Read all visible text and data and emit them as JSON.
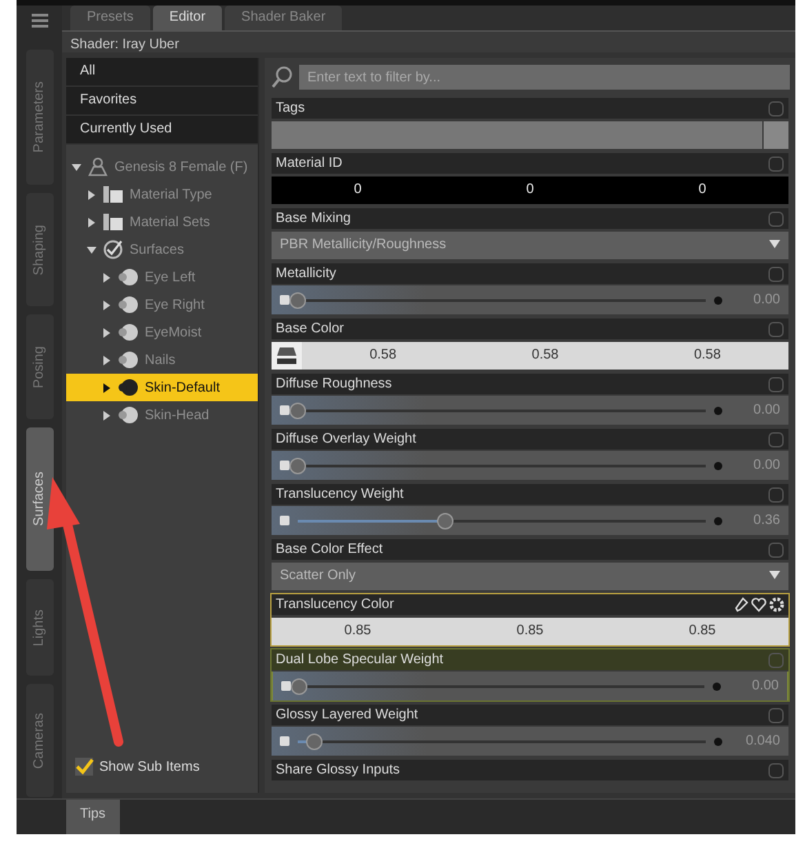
{
  "side_tabs": [
    {
      "label": "Parameters",
      "selected": false
    },
    {
      "label": "Shaping",
      "selected": false
    },
    {
      "label": "Posing",
      "selected": false
    },
    {
      "label": "Surfaces",
      "selected": true
    },
    {
      "label": "Lights",
      "selected": false
    },
    {
      "label": "Cameras",
      "selected": false
    }
  ],
  "tabs": [
    {
      "label": "Presets",
      "selected": false
    },
    {
      "label": "Editor",
      "selected": true
    },
    {
      "label": "Shader Baker",
      "selected": false
    }
  ],
  "shader_label": "Shader: Iray Uber",
  "filters": [
    "All",
    "Favorites",
    "Currently Used"
  ],
  "tree": [
    {
      "label": "Genesis 8 Female (F)",
      "kind": "figure",
      "expanded": true,
      "dimmed": true,
      "selected": false,
      "children": [
        {
          "label": "Material Type",
          "kind": "folder",
          "expanded": false,
          "dimmed": true,
          "selected": false
        },
        {
          "label": "Material Sets",
          "kind": "folder",
          "expanded": false,
          "dimmed": true,
          "selected": false
        },
        {
          "label": "Surfaces",
          "kind": "group",
          "expanded": true,
          "dimmed": true,
          "selected": false,
          "children": [
            {
              "label": "Eye Left",
              "kind": "surface",
              "expanded": false,
              "dimmed": true,
              "selected": false
            },
            {
              "label": "Eye Right",
              "kind": "surface",
              "expanded": false,
              "dimmed": true,
              "selected": false
            },
            {
              "label": "EyeMoist",
              "kind": "surface",
              "expanded": false,
              "dimmed": true,
              "selected": false
            },
            {
              "label": "Nails",
              "kind": "surface",
              "expanded": false,
              "dimmed": true,
              "selected": false
            },
            {
              "label": "Skin-Default",
              "kind": "surface",
              "expanded": false,
              "dimmed": false,
              "selected": true
            },
            {
              "label": "Skin-Head",
              "kind": "surface",
              "expanded": false,
              "dimmed": true,
              "selected": false
            }
          ]
        }
      ]
    }
  ],
  "show_sub_items": {
    "label": "Show Sub Items",
    "checked": true
  },
  "search": {
    "placeholder": "Enter text to filter by..."
  },
  "properties": [
    {
      "label": "Tags",
      "kind": "field",
      "selected": false,
      "hovered": false
    },
    {
      "label": "Material ID",
      "kind": "numbers",
      "values": [
        "0",
        "0",
        "0"
      ],
      "selected": false,
      "hovered": false
    },
    {
      "label": "Base Mixing",
      "kind": "dropdown",
      "value": "PBR Metallicity/Roughness",
      "selected": false,
      "hovered": false
    },
    {
      "label": "Metallicity",
      "kind": "slider",
      "level": 0,
      "reading": "0.00",
      "selected": false,
      "hovered": false
    },
    {
      "label": "Base Color",
      "kind": "color",
      "swatch": true,
      "values": [
        "0.58",
        "0.58",
        "0.58"
      ],
      "selected": false,
      "hovered": false
    },
    {
      "label": "Diffuse Roughness",
      "kind": "slider",
      "level": 0,
      "reading": "0.00",
      "selected": false,
      "hovered": false
    },
    {
      "label": "Diffuse Overlay Weight",
      "kind": "slider",
      "level": 0,
      "reading": "0.00",
      "selected": false,
      "hovered": false
    },
    {
      "label": "Translucency Weight",
      "kind": "slider",
      "level": 0.36,
      "reading": "0.36",
      "selected": false,
      "hovered": false
    },
    {
      "label": "Base Color Effect",
      "kind": "dropdown",
      "value": "Scatter Only",
      "selected": false,
      "hovered": false
    },
    {
      "label": "Translucency Color",
      "kind": "color",
      "swatch": false,
      "values": [
        "0.85",
        "0.85",
        "0.85"
      ],
      "selected": true,
      "hovered": false
    },
    {
      "label": "Dual Lobe Specular Weight",
      "kind": "slider",
      "level": 0,
      "reading": "0.00",
      "selected": false,
      "hovered": true
    },
    {
      "label": "Glossy Layered Weight",
      "kind": "slider",
      "level": 0.04,
      "reading": "0.040",
      "selected": false,
      "hovered": false
    },
    {
      "label": "Share Glossy Inputs",
      "kind": "header",
      "selected": false,
      "hovered": false
    }
  ],
  "bottom_tabs": [
    {
      "label": "Tips",
      "selected": true
    }
  ]
}
